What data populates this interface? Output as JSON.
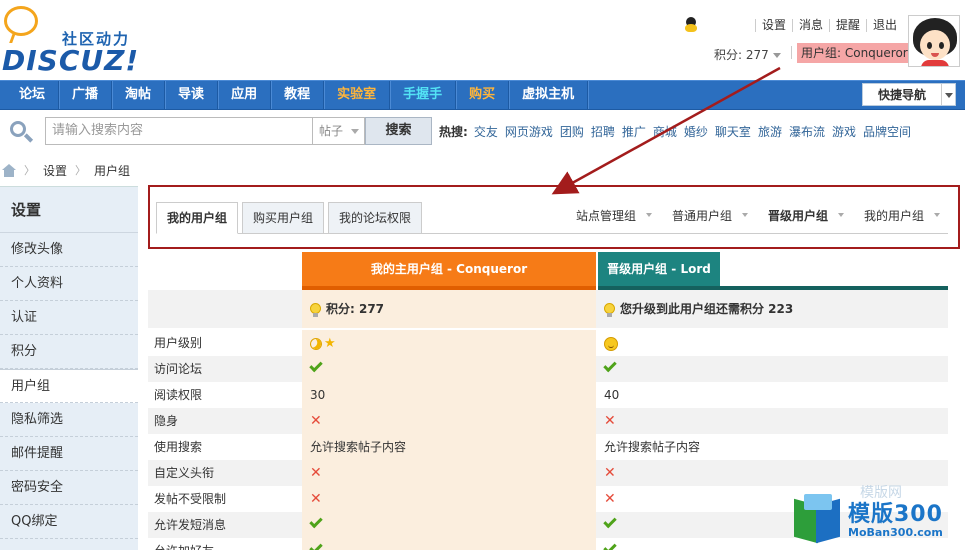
{
  "header": {
    "logo_slogan": "社区动力",
    "logo_word": "DISCUZ!",
    "top_links": [
      "设置",
      "消息",
      "提醒",
      "退出"
    ],
    "credits_label": "积分: 277",
    "usergroup_label": "用户组: Conqueror"
  },
  "nav": {
    "items": [
      {
        "label": "论坛",
        "color": "white"
      },
      {
        "label": "广播",
        "color": "white"
      },
      {
        "label": "淘帖",
        "color": "white"
      },
      {
        "label": "导读",
        "color": "white"
      },
      {
        "label": "应用",
        "color": "white"
      },
      {
        "label": "教程",
        "color": "white"
      },
      {
        "label": "实验室",
        "color": "orange"
      },
      {
        "label": "手握手",
        "color": "cyan"
      },
      {
        "label": "购买",
        "color": "orange"
      },
      {
        "label": "虚拟主机",
        "color": "white"
      }
    ],
    "quick_nav": "快捷导航"
  },
  "search": {
    "placeholder": "请输入搜索内容",
    "type": "帖子",
    "button": "搜索",
    "hot_label": "热搜:",
    "hot_items": [
      "交友",
      "网页游戏",
      "团购",
      "招聘",
      "推广",
      "商城",
      "婚纱",
      "聊天室",
      "旅游",
      "瀑布流",
      "游戏",
      "品牌空间"
    ]
  },
  "breadcrumb": [
    "设置",
    "用户组"
  ],
  "sidebar": {
    "title": "设置",
    "items": [
      "修改头像",
      "个人资料",
      "认证",
      "积分",
      "用户组",
      "隐私筛选",
      "邮件提醒",
      "密码安全",
      "QQ绑定"
    ],
    "active": "用户组"
  },
  "tabs": {
    "left": [
      "我的用户组",
      "购买用户组",
      "我的论坛权限"
    ],
    "right": [
      {
        "label": "站点管理组",
        "bold": false
      },
      {
        "label": "普通用户组",
        "bold": false
      },
      {
        "label": "晋级用户组",
        "bold": true
      },
      {
        "label": "我的用户组",
        "bold": false
      }
    ]
  },
  "table": {
    "current_head": "我的主用户组 - Conqueror",
    "next_head": "晋级用户组 - Lord",
    "current_credit": "积分: 277",
    "next_credit": "您升级到此用户组还需积分 223",
    "rows": [
      {
        "label": "用户级别",
        "c1": "icon:moon-star",
        "c2": "icon:sun"
      },
      {
        "label": "访问论坛",
        "c1": "icon:check",
        "c2": "icon:check"
      },
      {
        "label": "阅读权限",
        "c1": "30",
        "c2": "40"
      },
      {
        "label": "隐身",
        "c1": "icon:cross",
        "c2": "icon:cross"
      },
      {
        "label": "使用搜索",
        "c1": "允许搜索帖子内容",
        "c2": "允许搜索帖子内容"
      },
      {
        "label": "自定义头衔",
        "c1": "icon:cross",
        "c2": "icon:cross"
      },
      {
        "label": "发帖不受限制",
        "c1": "icon:cross",
        "c2": "icon:cross"
      },
      {
        "label": "允许发短消息",
        "c1": "icon:check",
        "c2": "icon:check"
      },
      {
        "label": "允许加好友",
        "c1": "icon:check",
        "c2": "icon:check"
      }
    ]
  },
  "watermark": {
    "title": "模版300",
    "sub": "MoBan300.com",
    "faint": "模版网"
  }
}
